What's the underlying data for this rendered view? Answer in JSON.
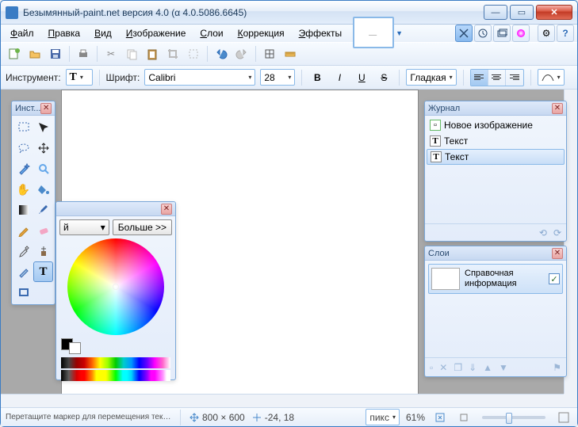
{
  "title": "Безымянный-paint.net версия 4.0 (α 4.0.5086.6645)",
  "menu": {
    "file": "Файл",
    "edit": "Правка",
    "view": "Вид",
    "image": "Изображение",
    "layers": "Слои",
    "adjust": "Коррекция",
    "effects": "Эффекты"
  },
  "toolopts": {
    "instrument_label": "Инструмент:",
    "font_label": "Шрифт:",
    "font": "Calibri",
    "size": "28",
    "smooth": "Гладкая"
  },
  "tools_panel": {
    "title": "Инст..."
  },
  "colors_panel": {
    "more": "Больше >>",
    "primary": "й"
  },
  "history": {
    "title": "Журнал",
    "items": [
      {
        "label": "Новое изображение",
        "icon": "img"
      },
      {
        "label": "Текст",
        "icon": "T"
      },
      {
        "label": "Текст",
        "icon": "T"
      }
    ]
  },
  "layers_panel": {
    "title": "Слои",
    "layer_name": "Справочная информация"
  },
  "status": {
    "hint": "Перетащите маркер для перемещения текста. Нажмите клавишу...",
    "dims": "800 × 600",
    "cursor": "-24, 18",
    "units": "пикс",
    "zoom": "61%"
  }
}
